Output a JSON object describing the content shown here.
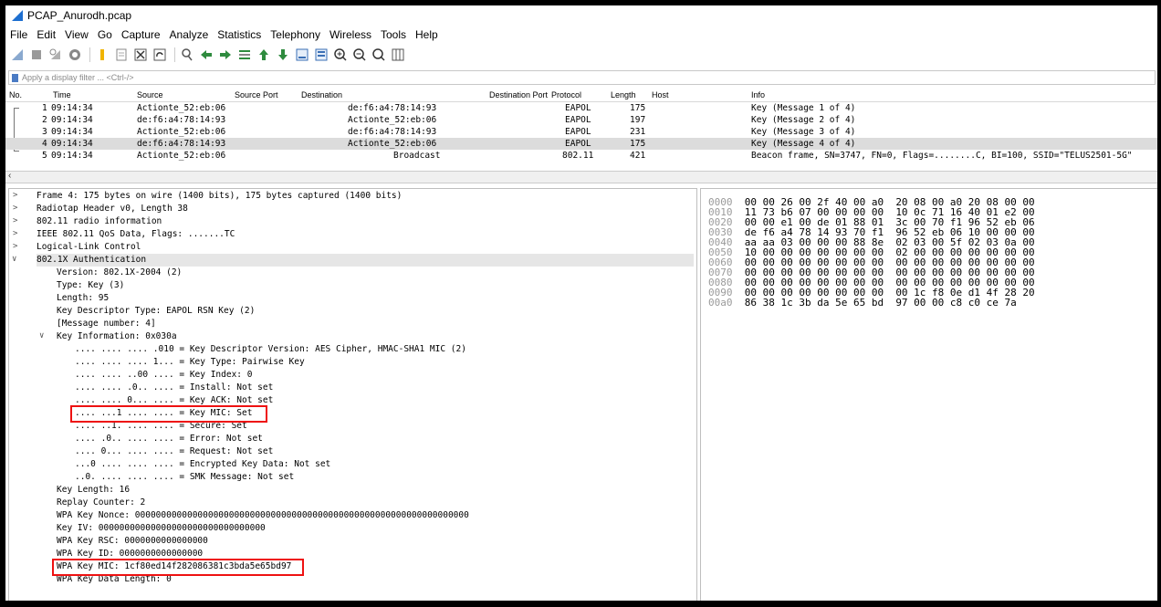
{
  "window": {
    "title": "PCAP_Anurodh.pcap"
  },
  "menu": [
    "File",
    "Edit",
    "View",
    "Go",
    "Capture",
    "Analyze",
    "Statistics",
    "Telephony",
    "Wireless",
    "Tools",
    "Help"
  ],
  "toolbar_icons": [
    "shark-fin-icon",
    "stop-icon",
    "restart-icon",
    "options-icon",
    "open-file-icon",
    "save-file-icon",
    "close-file-icon",
    "reload-icon",
    "find-icon",
    "back-icon",
    "forward-icon",
    "go-to-packet-icon",
    "first-packet-icon",
    "last-packet-icon",
    "autoscroll-icon",
    "colorize-icon",
    "zoom-in-icon",
    "zoom-out-icon",
    "normal-size-icon",
    "resize-columns-icon"
  ],
  "filter": {
    "placeholder": "Apply a display filter ... <Ctrl-/>"
  },
  "packet_list": {
    "columns": [
      "No.",
      "Time",
      "Source",
      "Source Port",
      "Destination",
      "Destination Port",
      "Protocol",
      "Length",
      "Host",
      "Info"
    ],
    "rows": [
      {
        "no": "1",
        "time": "09:14:34",
        "src": "Actionte_52:eb:06",
        "dst": "de:f6:a4:78:14:93",
        "proto": "EAPOL",
        "len": "175",
        "info": "Key (Message 1 of 4)"
      },
      {
        "no": "2",
        "time": "09:14:34",
        "src": "de:f6:a4:78:14:93",
        "dst": "Actionte_52:eb:06",
        "proto": "EAPOL",
        "len": "197",
        "info": "Key (Message 2 of 4)"
      },
      {
        "no": "3",
        "time": "09:14:34",
        "src": "Actionte_52:eb:06",
        "dst": "de:f6:a4:78:14:93",
        "proto": "EAPOL",
        "len": "231",
        "info": "Key (Message 3 of 4)"
      },
      {
        "no": "4",
        "time": "09:14:34",
        "src": "de:f6:a4:78:14:93",
        "dst": "Actionte_52:eb:06",
        "proto": "EAPOL",
        "len": "175",
        "info": "Key (Message 4 of 4)"
      },
      {
        "no": "5",
        "time": "09:14:34",
        "src": "Actionte_52:eb:06",
        "dst": "Broadcast",
        "proto": "802.11",
        "len": "421",
        "info": "Beacon frame, SN=3747, FN=0, Flags=........C, BI=100, SSID=\"TELUS2501-5G\""
      }
    ]
  },
  "detail": {
    "top": [
      "Frame 4: 175 bytes on wire (1400 bits), 175 bytes captured (1400 bits)",
      "Radiotap Header v0, Length 38",
      "802.11 radio information",
      "IEEE 802.11 QoS Data, Flags: .......TC",
      "Logical-Link Control",
      "802.1X Authentication"
    ],
    "auth": [
      "Version: 802.1X-2004 (2)",
      "Type: Key (3)",
      "Length: 95",
      "Key Descriptor Type: EAPOL RSN Key (2)",
      "[Message number: 4]",
      "Key Information: 0x030a"
    ],
    "keyinfo": [
      ".... .... .... .010 = Key Descriptor Version: AES Cipher, HMAC-SHA1 MIC (2)",
      ".... .... .... 1... = Key Type: Pairwise Key",
      ".... .... ..00 .... = Key Index: 0",
      ".... .... .0.. .... = Install: Not set",
      ".... .... 0... .... = Key ACK: Not set",
      ".... ...1 .... .... = Key MIC: Set",
      ".... ..1. .... .... = Secure: Set",
      ".... .0.. .... .... = Error: Not set",
      ".... 0... .... .... = Request: Not set",
      "...0 .... .... .... = Encrypted Key Data: Not set",
      "..0. .... .... .... = SMK Message: Not set"
    ],
    "rest": [
      "Key Length: 16",
      "Replay Counter: 2",
      "WPA Key Nonce: 0000000000000000000000000000000000000000000000000000000000000000",
      "Key IV: 00000000000000000000000000000000",
      "WPA Key RSC: 0000000000000000",
      "WPA Key ID: 0000000000000000",
      "WPA Key MIC: 1cf80ed14f282086381c3bda5e65bd97",
      "WPA Key Data Length: 0"
    ]
  },
  "hex": [
    {
      "off": "0000",
      "bytes": "00 00 26 00 2f 40 00 a0  20 08 00 a0 20 08 00 00"
    },
    {
      "off": "0010",
      "bytes": "11 73 b6 07 00 00 00 00  10 0c 71 16 40 01 e2 00"
    },
    {
      "off": "0020",
      "bytes": "00 00 e1 00 de 01 88 01  3c 00 70 f1 96 52 eb 06"
    },
    {
      "off": "0030",
      "bytes": "de f6 a4 78 14 93 70 f1  96 52 eb 06 10 00 00 00"
    },
    {
      "off": "0040",
      "bytes": "aa aa 03 00 00 00 88 8e  02 03 00 5f 02 03 0a 00"
    },
    {
      "off": "0050",
      "bytes": "10 00 00 00 00 00 00 00  02 00 00 00 00 00 00 00"
    },
    {
      "off": "0060",
      "bytes": "00 00 00 00 00 00 00 00  00 00 00 00 00 00 00 00"
    },
    {
      "off": "0070",
      "bytes": "00 00 00 00 00 00 00 00  00 00 00 00 00 00 00 00"
    },
    {
      "off": "0080",
      "bytes": "00 00 00 00 00 00 00 00  00 00 00 00 00 00 00 00"
    },
    {
      "off": "0090",
      "bytes": "00 00 00 00 00 00 00 00  00 1c f8 0e d1 4f 28 20"
    },
    {
      "off": "00a0",
      "bytes": "86 38 1c 3b da 5e 65 bd  97 00 00 c8 c0 ce 7a"
    }
  ]
}
